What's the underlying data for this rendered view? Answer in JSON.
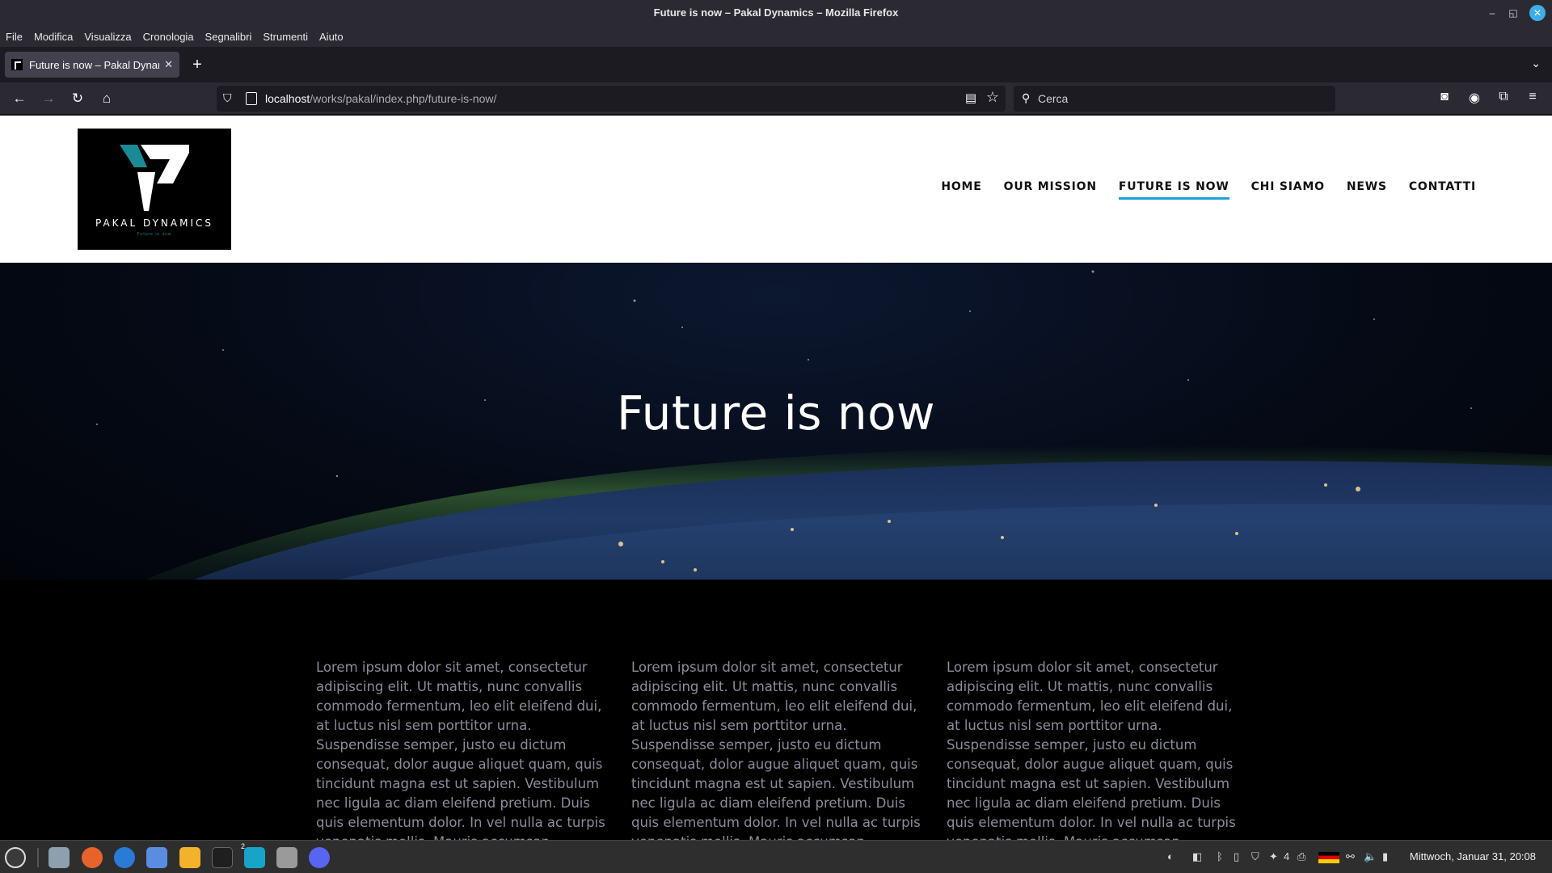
{
  "window": {
    "title": "Future is now – Pakal Dynamics – Mozilla Firefox"
  },
  "menu": [
    "File",
    "Modifica",
    "Visualizza",
    "Cronologia",
    "Segnalibri",
    "Strumenti",
    "Aiuto"
  ],
  "tab": {
    "title": "Future is now – Pakal Dynamics"
  },
  "urlbar": {
    "host": "localhost",
    "path": "/works/pakal/index.php/future-is-now/"
  },
  "search": {
    "placeholder": "Cerca"
  },
  "site": {
    "logo": {
      "brand": "PAKAL DYNAMICS",
      "tagline": "Future is now"
    },
    "nav": [
      "HOME",
      "OUR MISSION",
      "FUTURE IS NOW",
      "CHI SIAMO",
      "NEWS",
      "CONTATTI"
    ],
    "nav_active": "FUTURE IS NOW",
    "hero_title": "Future is now",
    "columns": [
      "Lorem ipsum dolor sit amet, consectetur adipiscing elit. Ut mattis, nunc convallis commodo fermentum, leo elit eleifend dui, at luctus nisl sem porttitor urna. Suspendisse semper, justo eu dictum consequat, dolor augue aliquet quam, quis tincidunt magna est ut sapien. Vestibulum nec ligula ac diam eleifend pretium. Duis quis elementum dolor. In vel nulla ac turpis venenatis mollis. Mauris accumsan accumsan justo quis aliquam.",
      "Lorem ipsum dolor sit amet, consectetur adipiscing elit. Ut mattis, nunc convallis commodo fermentum, leo elit eleifend dui, at luctus nisl sem porttitor urna. Suspendisse semper, justo eu dictum consequat, dolor augue aliquet quam, quis tincidunt magna est ut sapien. Vestibulum nec ligula ac diam eleifend pretium. Duis quis elementum dolor. In vel nulla ac turpis venenatis mollis. Mauris accumsan accumsan justo quis aliquam.",
      "Lorem ipsum dolor sit amet, consectetur adipiscing elit. Ut mattis, nunc convallis commodo fermentum, leo elit eleifend dui, at luctus nisl sem porttitor urna. Suspendisse semper, justo eu dictum consequat, dolor augue aliquet quam, quis tincidunt magna est ut sapien. Vestibulum nec ligula ac diam eleifend pretium. Duis quis elementum dolor. In vel nulla ac turpis venenatis mollis. Mauris accumsan accumsan justo quis aliquam."
    ]
  },
  "taskbar": {
    "apps": [
      "mint-menu-icon",
      "files-icon",
      "firefox-icon",
      "thunderbird-icon",
      "screenshot-icon",
      "calculator-icon",
      "terminal-icon",
      "webstorm-icon",
      "settings-icon",
      "discord-icon"
    ],
    "workspace_badge": "2",
    "notification_count": "4",
    "clock": "Mittwoch, Januar 31, 20:08"
  },
  "colors": {
    "accent": "#1ea0d8",
    "logo_teal": "#1a8b96",
    "paragraph": "#8a8d9c"
  }
}
